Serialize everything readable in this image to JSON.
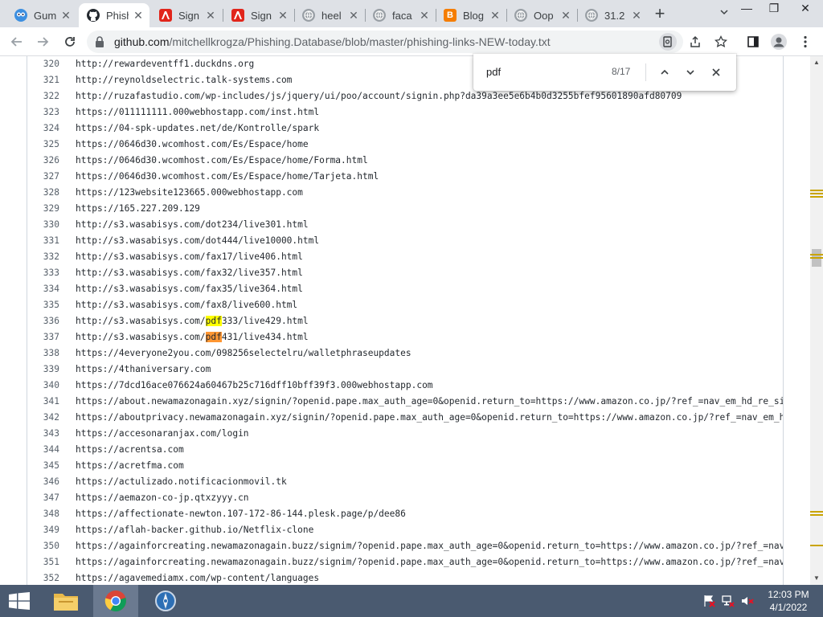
{
  "browser": {
    "tabs": [
      {
        "title": "Gum",
        "icon": "owl-icon"
      },
      {
        "title": "Phish",
        "icon": "github-icon",
        "active": true
      },
      {
        "title": "Sign",
        "icon": "adobe-icon"
      },
      {
        "title": "Sign",
        "icon": "adobe-icon"
      },
      {
        "title": "heel",
        "icon": "globe-icon"
      },
      {
        "title": "faca",
        "icon": "globe-icon"
      },
      {
        "title": "Blog",
        "icon": "blogger-icon"
      },
      {
        "title": "Oop",
        "icon": "globe-icon"
      },
      {
        "title": "31.2",
        "icon": "globe-icon"
      }
    ],
    "address": {
      "host": "github.com",
      "path": "/mitchellkrogza/Phishing.Database/blob/master/phishing-links-NEW-today.txt"
    },
    "find": {
      "query": "pdf",
      "count": "8/17"
    }
  },
  "file_lines": [
    {
      "num": "320",
      "text": "http://rewardeventff1.duckdns.org"
    },
    {
      "num": "321",
      "text": "http://reynoldselectric.talk-systems.com"
    },
    {
      "num": "322",
      "text": "http://ruzafastudio.com/wp-includes/js/jquery/ui/poo/account/signin.php?da39a3ee5e6b4b0d3255bfef95601890afd80709"
    },
    {
      "num": "323",
      "text": "https://011111111.000webhostapp.com/inst.html"
    },
    {
      "num": "324",
      "text": "https://04-spk-updates.net/de/Kontrolle/spark"
    },
    {
      "num": "325",
      "text": "https://0646d30.wcomhost.com/Es/Espace/home"
    },
    {
      "num": "326",
      "text": "https://0646d30.wcomhost.com/Es/Espace/home/Forma.html"
    },
    {
      "num": "327",
      "text": "https://0646d30.wcomhost.com/Es/Espace/home/Tarjeta.html"
    },
    {
      "num": "328",
      "text": "https://123website123665.000webhostapp.com"
    },
    {
      "num": "329",
      "text": "https://165.227.209.129"
    },
    {
      "num": "330",
      "text": "http://s3.wasabisys.com/dot234/live301.html"
    },
    {
      "num": "331",
      "text": "http://s3.wasabisys.com/dot444/live10000.html"
    },
    {
      "num": "332",
      "text": "http://s3.wasabisys.com/fax17/live406.html"
    },
    {
      "num": "333",
      "text": "http://s3.wasabisys.com/fax32/live357.html"
    },
    {
      "num": "334",
      "text": "http://s3.wasabisys.com/fax35/live364.html"
    },
    {
      "num": "335",
      "text": "http://s3.wasabisys.com/fax8/live600.html"
    },
    {
      "num": "336",
      "pre": "http://s3.wasabisys.com/",
      "match": "pdf",
      "post": "333/live429.html",
      "hl": "match"
    },
    {
      "num": "337",
      "pre": "http://s3.wasabisys.com/",
      "match": "pdf",
      "post": "431/live434.html",
      "hl": "current"
    },
    {
      "num": "338",
      "text": "https://4everyone2you.com/098256selectelru/walletphraseupdates"
    },
    {
      "num": "339",
      "text": "https://4thaniversary.com"
    },
    {
      "num": "340",
      "text": "https://7dcd16ace076624a60467b25c716dff10bff39f3.000webhostapp.com"
    },
    {
      "num": "341",
      "text": "https://about.newamazonagain.xyz/signin/?openid.pape.max_auth_age=0&openid.return_to=https://www.amazon.co.jp/?ref_=nav_em_hd_re_signi"
    },
    {
      "num": "342",
      "text": "https://aboutprivacy.newamazonagain.xyz/signin/?openid.pape.max_auth_age=0&openid.return_to=https://www.amazon.co.jp/?ref_=nav_em_hd_r"
    },
    {
      "num": "343",
      "text": "https://accesonaranjax.com/login"
    },
    {
      "num": "344",
      "text": "https://acrentsa.com"
    },
    {
      "num": "345",
      "text": "https://acretfma.com"
    },
    {
      "num": "346",
      "text": "https://actulizado.notificacionmovil.tk"
    },
    {
      "num": "347",
      "text": "https://aemazon-co-jp.qtxzyyy.cn"
    },
    {
      "num": "348",
      "text": "https://affectionate-newton.107-172-86-144.plesk.page/p/dee86"
    },
    {
      "num": "349",
      "text": "https://aflah-backer.github.io/Netflix-clone"
    },
    {
      "num": "350",
      "text": "https://againforcreating.newamazonagain.buzz/signim/?openid.pape.max_auth_age=0&openid.return_to=https://www.amazon.co.jp/?ref_=nav_em"
    },
    {
      "num": "351",
      "text": "https://againforcreating.newamazonagain.buzz/signim/?openid.pape.max_auth_age=0&openid.return_to=https://www.amazon.co.jp/?ref_=nav_em"
    },
    {
      "num": "352",
      "text": "https://agavemediamx.com/wp-content/languages"
    }
  ],
  "taskbar": {
    "time": "12:03 PM",
    "date": "4/1/2022"
  },
  "colors": {
    "match_highlight": "#ffff00",
    "current_match_highlight": "#ff9632",
    "find_marker": "#c9a400",
    "taskbar": "#4a5a70"
  }
}
